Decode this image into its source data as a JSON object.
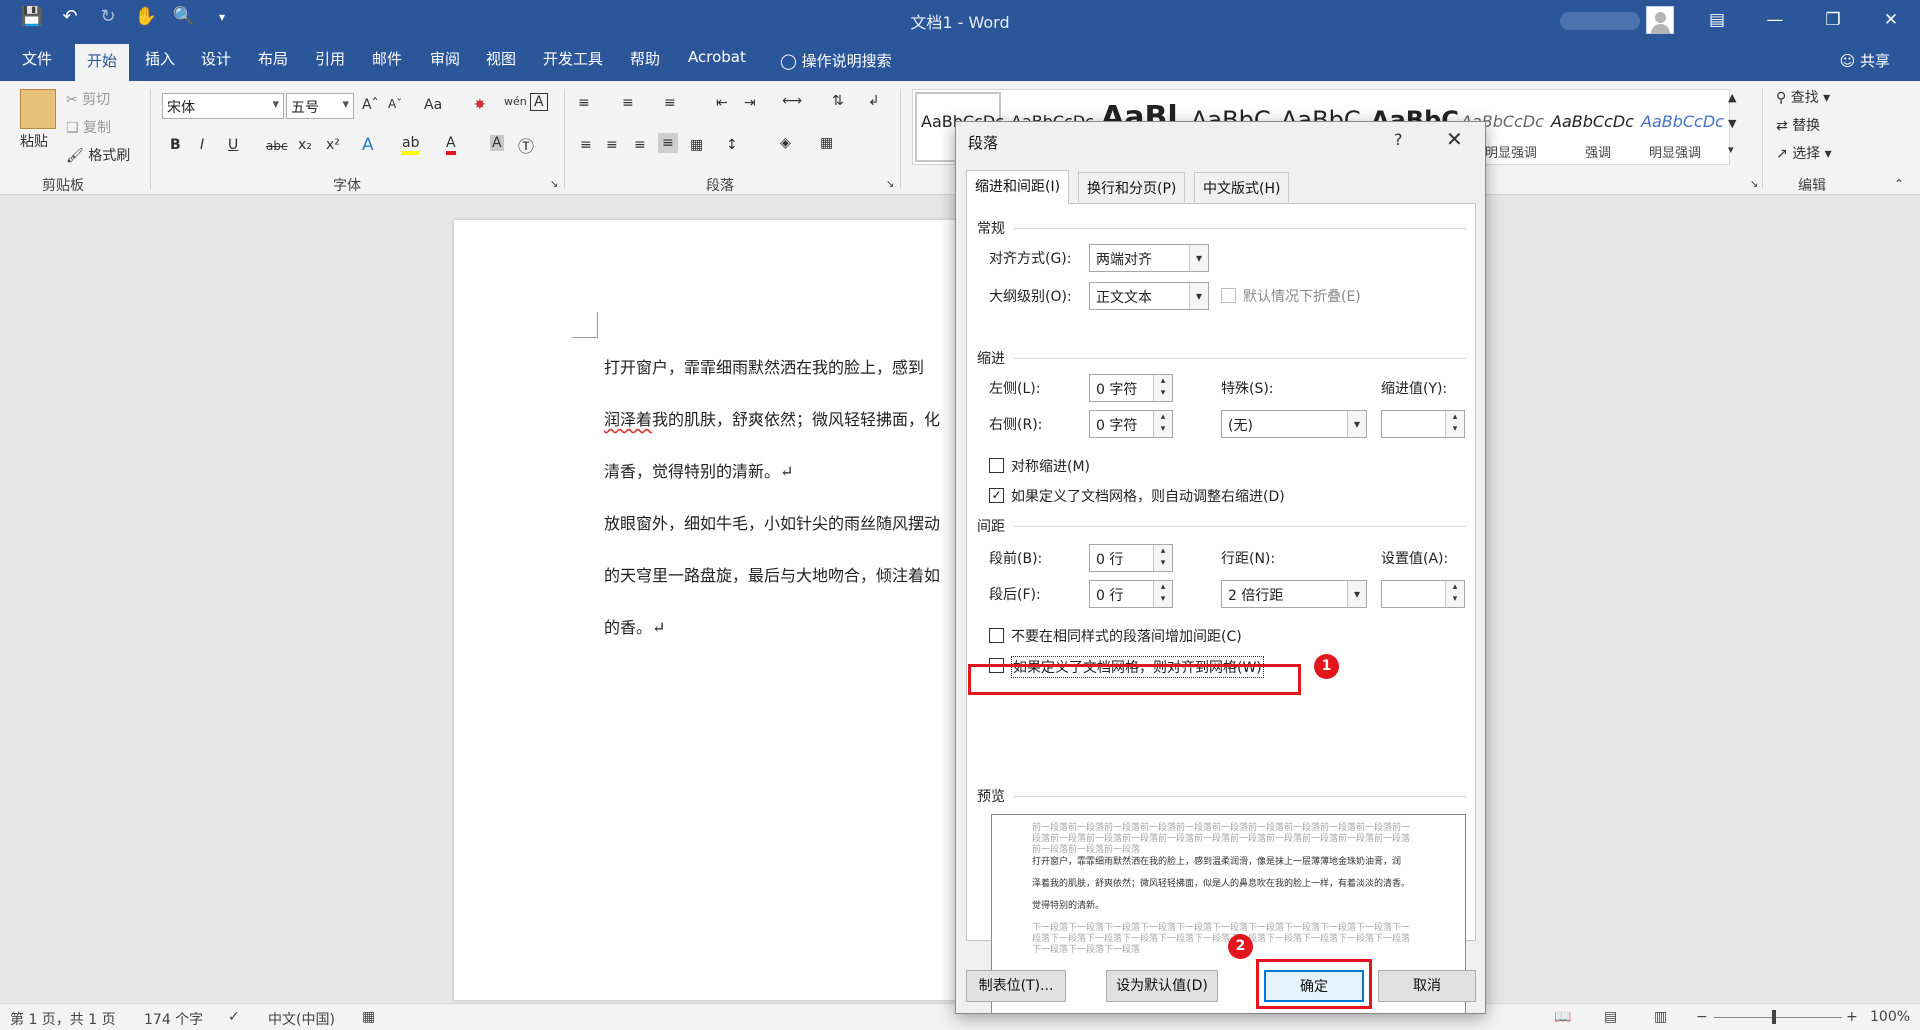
{
  "window": {
    "title": "文档1  -  Word",
    "controls": [
      "ribbon-display-icon",
      "minimize-icon",
      "restore-icon",
      "close-icon"
    ]
  },
  "menu": {
    "tabs": [
      "文件",
      "开始",
      "插入",
      "设计",
      "布局",
      "引用",
      "邮件",
      "审阅",
      "视图",
      "开发工具",
      "帮助",
      "Acrobat"
    ],
    "active": "开始",
    "tell_me": "操作说明搜索",
    "share": "共享"
  },
  "ribbon": {
    "clipboard": {
      "paste": "粘贴",
      "cut": "剪切",
      "copy": "复制",
      "format_painter": "格式刷",
      "label": "剪贴板"
    },
    "font": {
      "name": "宋体",
      "size": "五号",
      "case": "Aa",
      "label": "字体"
    },
    "paragraph": {
      "label": "段落"
    },
    "styles": {
      "items": [
        "AaBbCcDc",
        "AaBbCcDc",
        "AaBl",
        "AaBbC",
        "AaBbC",
        "AaBbC",
        "AaBbCcDc",
        "AaBbCcDc",
        "AaBbCcDc"
      ],
      "names": [
        "明显强调",
        "强调",
        "明显强调"
      ]
    },
    "editing": {
      "find": "查找",
      "replace": "替换",
      "select": "选择",
      "label": "编辑"
    }
  },
  "document": {
    "lines": [
      "打开窗户，霏霏细雨默然洒在我的脸上，感到",
      "润泽着我的肌肤，舒爽依然；微风轻轻拂面，化",
      "清香，觉得特别的清新。↵",
      "放眼窗外，细如牛毛，小如针尖的雨丝随风摆动",
      "的天穹里一路盘旋，最后与大地吻合，倾注着如",
      "的香。↵"
    ],
    "squiggle_word": "润泽着"
  },
  "status": {
    "page": "第 1 页，共 1 页",
    "words": "174 个字",
    "language": "中文(中国)",
    "zoom": "100%"
  },
  "dialog": {
    "title": "段落",
    "help": "?",
    "tabs": [
      "缩进和间距(I)",
      "换行和分页(P)",
      "中文版式(H)"
    ],
    "general": {
      "section": "常规",
      "alignment_label": "对齐方式(G):",
      "alignment_value": "两端对齐",
      "outline_label": "大纲级别(O):",
      "outline_value": "正文文本",
      "collapse_label": "默认情况下折叠(E)"
    },
    "indent": {
      "section": "缩进",
      "left_label": "左侧(L):",
      "left_value": "0 字符",
      "right_label": "右侧(R):",
      "right_value": "0 字符",
      "special_label": "特殊(S):",
      "special_value": "(无)",
      "by_label": "缩进值(Y):",
      "mirror_label": "对称缩进(M)",
      "auto_adjust_label": "如果定义了文档网格，则自动调整右缩进(D)",
      "auto_adjust_checked": true
    },
    "spacing": {
      "section": "间距",
      "before_label": "段前(B):",
      "before_value": "0 行",
      "after_label": "段后(F):",
      "after_value": "0 行",
      "line_label": "行距(N):",
      "line_value": "2 倍行距",
      "at_label": "设置值(A):",
      "dont_add_label": "不要在相同样式的段落间增加间距(C)",
      "snap_grid_label": "如果定义了文档网格，则对齐到网格(W)",
      "snap_grid_checked": false
    },
    "preview": {
      "section": "预览",
      "before_text": "前一段落前一段落前一段落前一段落前一段落前一段落前一段落前一段落前一段落前一段落前一段落前一段落前一段落前一段落前一段落前一段落前一段落前一段落前一段落前一段落前一段落前一段落前一段落前一段落",
      "sample_lines": [
        "打开窗户，霏霏细雨默然洒在我的脸上，感到温柔润滑，像是抹上一层薄薄地金珠奶油膏，润",
        "泽着我的肌肤，舒爽依然；微风轻轻拂面，似是人的鼻息吹在我的脸上一样，有着淡淡的清香。",
        "觉得特别的清新。"
      ],
      "after_text": "下一段落下一段落下一段落下一段落下一段落下一段落下一段落下一段落下一段落下一段落下一段落下一段落下一段落下一段落下一段落下一段落下一段落下一段落下一段落下一段落下一段落下一段落下一段落下一段落"
    },
    "buttons": {
      "tabs": "制表位(T)...",
      "default": "设为默认值(D)",
      "ok": "确定",
      "cancel": "取消"
    }
  },
  "annotations": {
    "marker1": "1",
    "marker2": "2",
    "highlight_color": "#e3151d"
  }
}
